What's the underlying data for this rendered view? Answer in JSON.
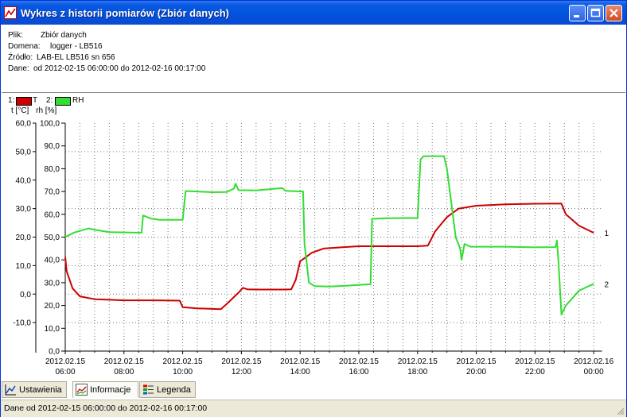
{
  "window": {
    "title": "Wykres z historii pomiarów (Zbiór danych)",
    "icon": "chart-app-icon"
  },
  "info": {
    "rows": [
      {
        "label": "Plik:",
        "value": "Zbiór danych"
      },
      {
        "label": "Domena:",
        "value": "logger - LB516"
      },
      {
        "label": "Źródło:",
        "value": "LAB-EL LB516 sn 656"
      },
      {
        "label": "Dane:",
        "value": "od 2012-02-15 06:00:00 do 2012-02-16 00:17:00"
      }
    ]
  },
  "legend": {
    "items": [
      {
        "index": "1:",
        "name": "T",
        "color": "#cc0000"
      },
      {
        "index": "2:",
        "name": "RH",
        "color": "#33dd33"
      }
    ]
  },
  "axis_units": {
    "left": "t [°C]",
    "right": "rh [%]"
  },
  "chart_data": {
    "type": "line",
    "x_unit": "hours since 2012-02-15 06:00",
    "x_ticks": [
      {
        "date": "2012.02.15",
        "time": "06:00"
      },
      {
        "date": "2012.02.15",
        "time": "08:00"
      },
      {
        "date": "2012.02.15",
        "time": "10:00"
      },
      {
        "date": "2012.02.15",
        "time": "12:00"
      },
      {
        "date": "2012.02.15",
        "time": "14:00"
      },
      {
        "date": "2012.02.15",
        "time": "16:00"
      },
      {
        "date": "2012.02.15",
        "time": "18:00"
      },
      {
        "date": "2012.02.15",
        "time": "20:00"
      },
      {
        "date": "2012.02.15",
        "time": "22:00"
      },
      {
        "date": "2012.02.16",
        "time": "00:00"
      }
    ],
    "xlim": [
      "2012-02-15 06:00",
      "2012-02-16 00:17"
    ],
    "y_left": {
      "label": "t [°C]",
      "ylim": [
        -20,
        60
      ],
      "ticks": [
        "60,0",
        "50,0",
        "40,0",
        "30,0",
        "20,0",
        "10,0",
        "0,0",
        "-10,0"
      ]
    },
    "y_right": {
      "label": "rh [%]",
      "ylim": [
        0,
        100
      ],
      "ticks": [
        "100,0",
        "90,0",
        "80,0",
        "70,0",
        "60,0",
        "50,0",
        "40,0",
        "30,0",
        "20,0",
        "10,0",
        "0,0"
      ]
    },
    "grid": true,
    "series": [
      {
        "name": "T",
        "axis": "left",
        "color": "#cc0000",
        "end_label": "1",
        "points": [
          [
            0,
            13
          ],
          [
            0.05,
            8
          ],
          [
            0.25,
            2
          ],
          [
            0.5,
            -0.8
          ],
          [
            1,
            -1.8
          ],
          [
            1.5,
            -2
          ],
          [
            2,
            -2.2
          ],
          [
            3,
            -2.2
          ],
          [
            3.9,
            -2.3
          ],
          [
            4,
            -4.6
          ],
          [
            4.5,
            -5
          ],
          [
            5,
            -5.2
          ],
          [
            5.3,
            -5.3
          ],
          [
            5.5,
            -3.5
          ],
          [
            5.9,
            0.5
          ],
          [
            6.05,
            2.2
          ],
          [
            6.2,
            1.7
          ],
          [
            6.5,
            1.6
          ],
          [
            7,
            1.6
          ],
          [
            7.5,
            1.6
          ],
          [
            7.7,
            1.7
          ],
          [
            7.85,
            5
          ],
          [
            8,
            11.5
          ],
          [
            8.4,
            14.5
          ],
          [
            8.8,
            16
          ],
          [
            9.5,
            16.5
          ],
          [
            10,
            16.8
          ],
          [
            11,
            16.8
          ],
          [
            12,
            16.8
          ],
          [
            12.35,
            17
          ],
          [
            12.6,
            22
          ],
          [
            13,
            27
          ],
          [
            13.4,
            30
          ],
          [
            14,
            31
          ],
          [
            15,
            31.5
          ],
          [
            16,
            31.7
          ],
          [
            16.9,
            31.8
          ],
          [
            17.05,
            28
          ],
          [
            17.5,
            24
          ],
          [
            18,
            21.5
          ],
          [
            19,
            18.8
          ],
          [
            20,
            17.5
          ],
          [
            21,
            16.7
          ],
          [
            22,
            16.2
          ],
          [
            23,
            15.9
          ],
          [
            24.28,
            15.7
          ]
        ]
      },
      {
        "name": "RH",
        "axis": "right",
        "color": "#33dd33",
        "end_label": "2",
        "points": [
          [
            0,
            50
          ],
          [
            0.3,
            52
          ],
          [
            0.8,
            53.8
          ],
          [
            1,
            53.2
          ],
          [
            1.5,
            52.2
          ],
          [
            2.6,
            51.9
          ],
          [
            2.65,
            59.5
          ],
          [
            2.9,
            58.2
          ],
          [
            3.2,
            57.6
          ],
          [
            4,
            57.6
          ],
          [
            4.1,
            70.2
          ],
          [
            4.5,
            70
          ],
          [
            5,
            69.7
          ],
          [
            5.5,
            69.8
          ],
          [
            5.75,
            71.3
          ],
          [
            5.8,
            73.5
          ],
          [
            5.9,
            70.6
          ],
          [
            6.5,
            70.5
          ],
          [
            7.4,
            71.5
          ],
          [
            7.5,
            70.3
          ],
          [
            8.1,
            70
          ],
          [
            8.15,
            47
          ],
          [
            8.3,
            30
          ],
          [
            8.5,
            28.5
          ],
          [
            9,
            28.3
          ],
          [
            9.5,
            28.6
          ],
          [
            10.2,
            29.2
          ],
          [
            10.4,
            29.3
          ],
          [
            10.45,
            58
          ],
          [
            11,
            58.3
          ],
          [
            11.7,
            58.4
          ],
          [
            12,
            58.3
          ],
          [
            12.1,
            84
          ],
          [
            12.2,
            85.5
          ],
          [
            12.9,
            85.5
          ],
          [
            13,
            80
          ],
          [
            13.3,
            50
          ],
          [
            13.45,
            45
          ],
          [
            13.5,
            40
          ],
          [
            13.6,
            47
          ],
          [
            13.8,
            45.8
          ],
          [
            15,
            45.8
          ],
          [
            16,
            45.5
          ],
          [
            16.7,
            45.6
          ],
          [
            16.75,
            48.5
          ],
          [
            16.8,
            39
          ],
          [
            16.9,
            16
          ],
          [
            17.05,
            20
          ],
          [
            17.5,
            26.5
          ],
          [
            18,
            29.5
          ],
          [
            19,
            30.5
          ],
          [
            20,
            30.4
          ],
          [
            21,
            29.8
          ],
          [
            22,
            29
          ],
          [
            23,
            28.3
          ],
          [
            24.28,
            27.8
          ]
        ]
      }
    ]
  },
  "tabs": [
    {
      "label": "Ustawienia",
      "icon": "settings-chart-icon",
      "active": false
    },
    {
      "label": "Informacje",
      "icon": "info-chart-icon",
      "active": true
    },
    {
      "label": "Legenda",
      "icon": "legend-icon",
      "active": false
    }
  ],
  "status": {
    "text": "Dane od 2012-02-15 06:00:00 do 2012-02-16 00:17:00"
  }
}
